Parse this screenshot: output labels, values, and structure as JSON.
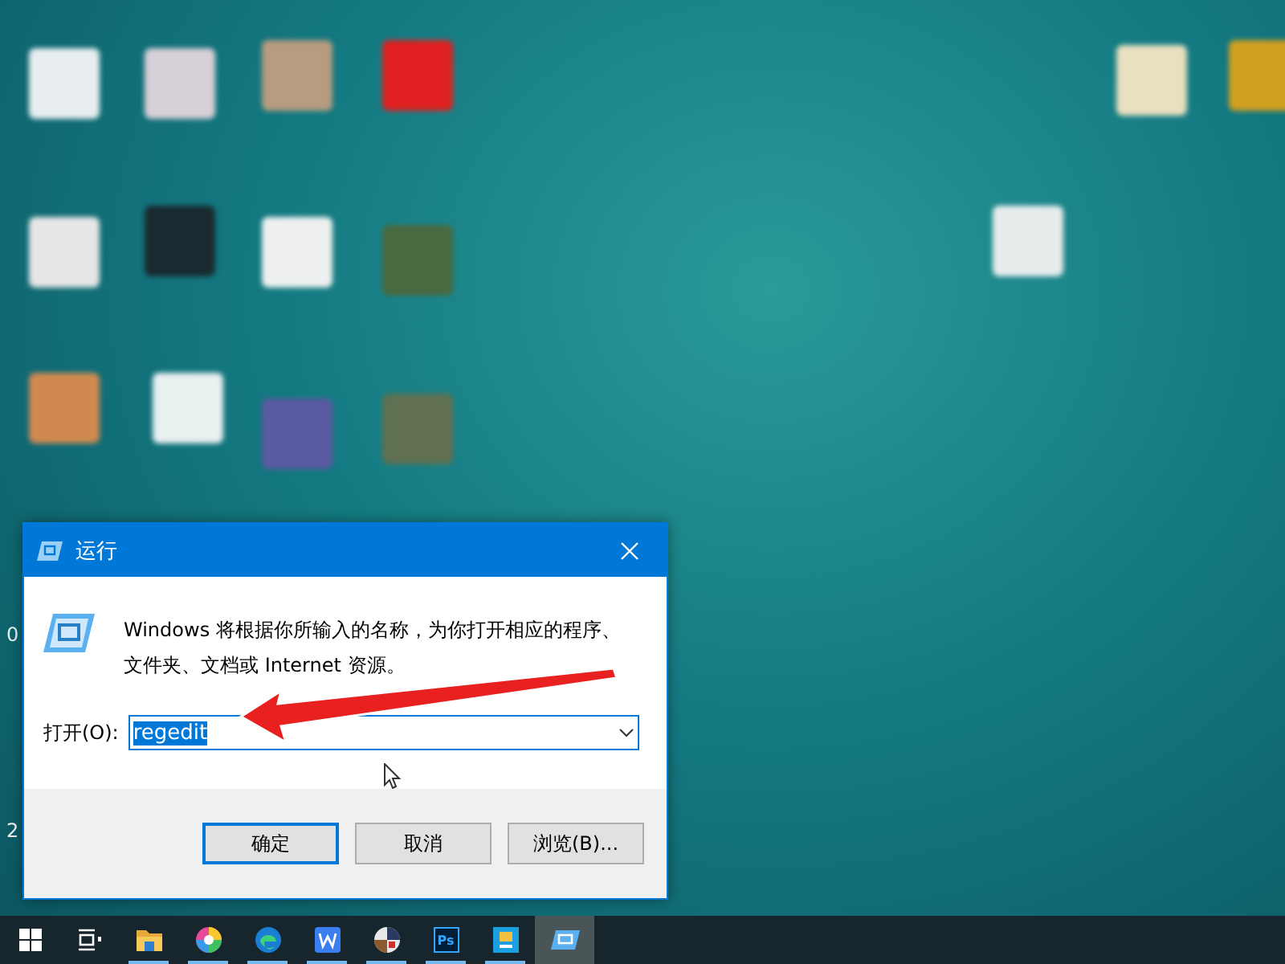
{
  "desktop": {
    "edge_texts": [
      "0",
      "2"
    ]
  },
  "dialog": {
    "title": "运行",
    "message": "Windows 将根据你所输入的名称，为你打开相应的程序、文件夹、文档或 Internet 资源。",
    "open_label": "打开(O):",
    "value": "regedit",
    "value_selected": true,
    "buttons": [
      {
        "label": "确定",
        "default": true
      },
      {
        "label": "取消",
        "default": false
      },
      {
        "label": "浏览(B)...",
        "default": false
      }
    ]
  },
  "taskbar": {
    "items": [
      {
        "kind": "start",
        "running": false,
        "selected": false
      },
      {
        "kind": "taskview",
        "running": false,
        "selected": false
      },
      {
        "kind": "folder",
        "running": true,
        "selected": false
      },
      {
        "kind": "colorwheel",
        "running": true,
        "selected": false
      },
      {
        "kind": "browser",
        "running": true,
        "selected": false
      },
      {
        "kind": "office",
        "running": true,
        "selected": false
      },
      {
        "kind": "game",
        "running": true,
        "selected": false
      },
      {
        "kind": "photoshop",
        "label": "Ps",
        "running": true,
        "selected": false
      },
      {
        "kind": "tool",
        "running": true,
        "selected": false
      },
      {
        "kind": "run",
        "running": false,
        "selected": true
      }
    ]
  }
}
